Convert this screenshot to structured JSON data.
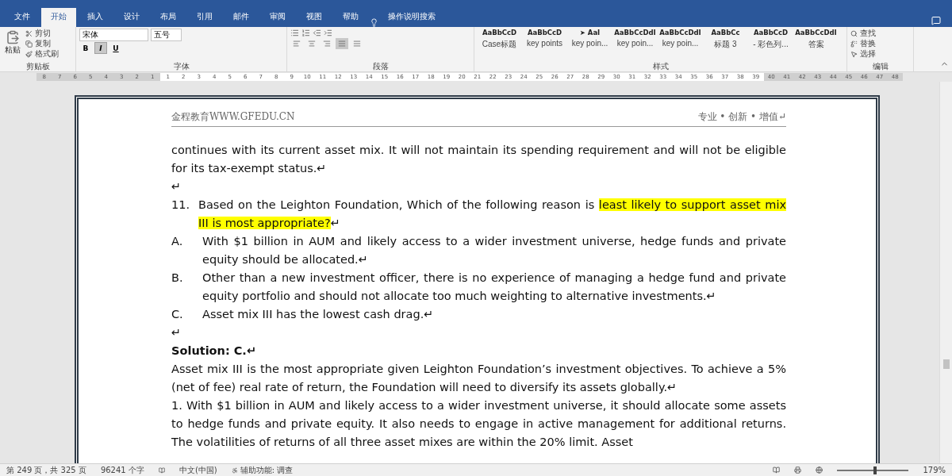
{
  "ribbon_tabs": [
    {
      "label": "文件",
      "selected": false
    },
    {
      "label": "开始",
      "selected": true
    },
    {
      "label": "插入",
      "selected": false
    },
    {
      "label": "设计",
      "selected": false
    },
    {
      "label": "布局",
      "selected": false
    },
    {
      "label": "引用",
      "selected": false
    },
    {
      "label": "邮件",
      "selected": false
    },
    {
      "label": "审阅",
      "selected": false
    },
    {
      "label": "视图",
      "selected": false
    },
    {
      "label": "帮助",
      "selected": false
    }
  ],
  "tell_me": "操作说明搜索",
  "ribbon": {
    "clipboard": {
      "label": "剪贴板",
      "paste": "粘贴",
      "cut": "剪切",
      "copy": "复制",
      "format_painter": "格式刷"
    },
    "font": {
      "label": "字体",
      "name": "宋体",
      "size": "五号",
      "format_buttons": [
        {
          "label": "B",
          "selected": false
        },
        {
          "label": "I",
          "selected": true
        },
        {
          "label": "U",
          "selected": false
        }
      ]
    },
    "paragraph": {
      "label": "段落",
      "align_buttons": [
        {
          "selected": false
        },
        {
          "selected": false
        },
        {
          "selected": false
        },
        {
          "selected": true
        },
        {
          "selected": false
        }
      ]
    },
    "styles": {
      "label": "样式",
      "items": [
        {
          "preview": "AaBbCcD",
          "name": "Case标题"
        },
        {
          "preview": "AaBbCcD",
          "name": "key points"
        },
        {
          "preview": "➤ AaI",
          "name": "key poin..."
        },
        {
          "preview": "AaBbCcDdI",
          "name": "key poin..."
        },
        {
          "preview": "AaBbCcDdI",
          "name": "key poin..."
        },
        {
          "preview": "AaBbCc",
          "name": "标题 3"
        },
        {
          "preview": "AaBbCcD",
          "name": "- 彩色列..."
        },
        {
          "preview": "AaBbCcDdI",
          "name": "答案"
        }
      ]
    },
    "editing": {
      "label": "编辑",
      "find": "查找",
      "replace": "替换",
      "select": "选择"
    }
  },
  "ruler": {
    "before": [
      "8",
      "7",
      "6",
      "5",
      "4",
      "3",
      "2",
      "1"
    ],
    "main": [
      "1",
      "2",
      "3",
      "4",
      "5",
      "6",
      "7",
      "8",
      "9",
      "10",
      "11",
      "12",
      "13",
      "14",
      "15",
      "16",
      "17",
      "18",
      "19",
      "20",
      "21",
      "22",
      "23",
      "24",
      "25",
      "26",
      "27",
      "28",
      "29",
      "30",
      "31",
      "32",
      "33",
      "34",
      "35",
      "36",
      "37",
      "38",
      "39"
    ],
    "after": [
      "40",
      "41",
      "42",
      "43",
      "44",
      "45",
      "46",
      "47",
      "48"
    ]
  },
  "document": {
    "header_left": "金程教育WWW.GFEDU.CN",
    "header_right": "专业 • 创新 • 增值↵",
    "blocks": [
      {
        "kind": "text",
        "text": "continues with its current asset mix. It will not maintain its spending requirement and will not be eligible for its tax-exempt status.↵"
      },
      {
        "kind": "blank",
        "text": "↵"
      },
      {
        "kind": "question",
        "number": "11.",
        "text": "Based on the Leighton Foundation, Which of the following reason is ",
        "highlight": "least likely to support asset mix III is most appropriate?",
        "tail": "↵"
      },
      {
        "kind": "option",
        "letter": "A.",
        "text": "With $1 billion in AUM and likely access to a wider investment universe, hedge funds and private equity should be allocated.↵"
      },
      {
        "kind": "option",
        "letter": "B.",
        "text": "Other than a new investment officer, there is no experience of managing a hedge fund and private equity portfolio and should not allocate too much weighting to alternative investments.↵"
      },
      {
        "kind": "option",
        "letter": "C.",
        "text": "Asset mix III has the lowest cash drag.↵"
      },
      {
        "kind": "blank",
        "text": "↵"
      },
      {
        "kind": "heading",
        "text": "Solution: C.↵"
      },
      {
        "kind": "text",
        "text": "Asset mix III is the most appropriate given Leighton Foundation’s investment objectives. To achieve a 5% (net of fee) real rate of return, the Foundation will need to diversify its assets globally.↵"
      },
      {
        "kind": "text",
        "text": "1. With $1 billion in AUM and likely access to a wider investment universe, it should allocate some assets to hedge funds and private equity. It also needs to engage in active management for additional returns. The volatilities of returns of all three asset mixes are within the 20% limit. Asset"
      }
    ]
  },
  "status_bar": {
    "page": "第 249 页，共 325 页",
    "words": "96241 个字",
    "language": "中文(中国)",
    "accessibility": "辅助功能: 调查",
    "zoom": "179%",
    "zoom_level": {
      "level": 0.53
    }
  }
}
